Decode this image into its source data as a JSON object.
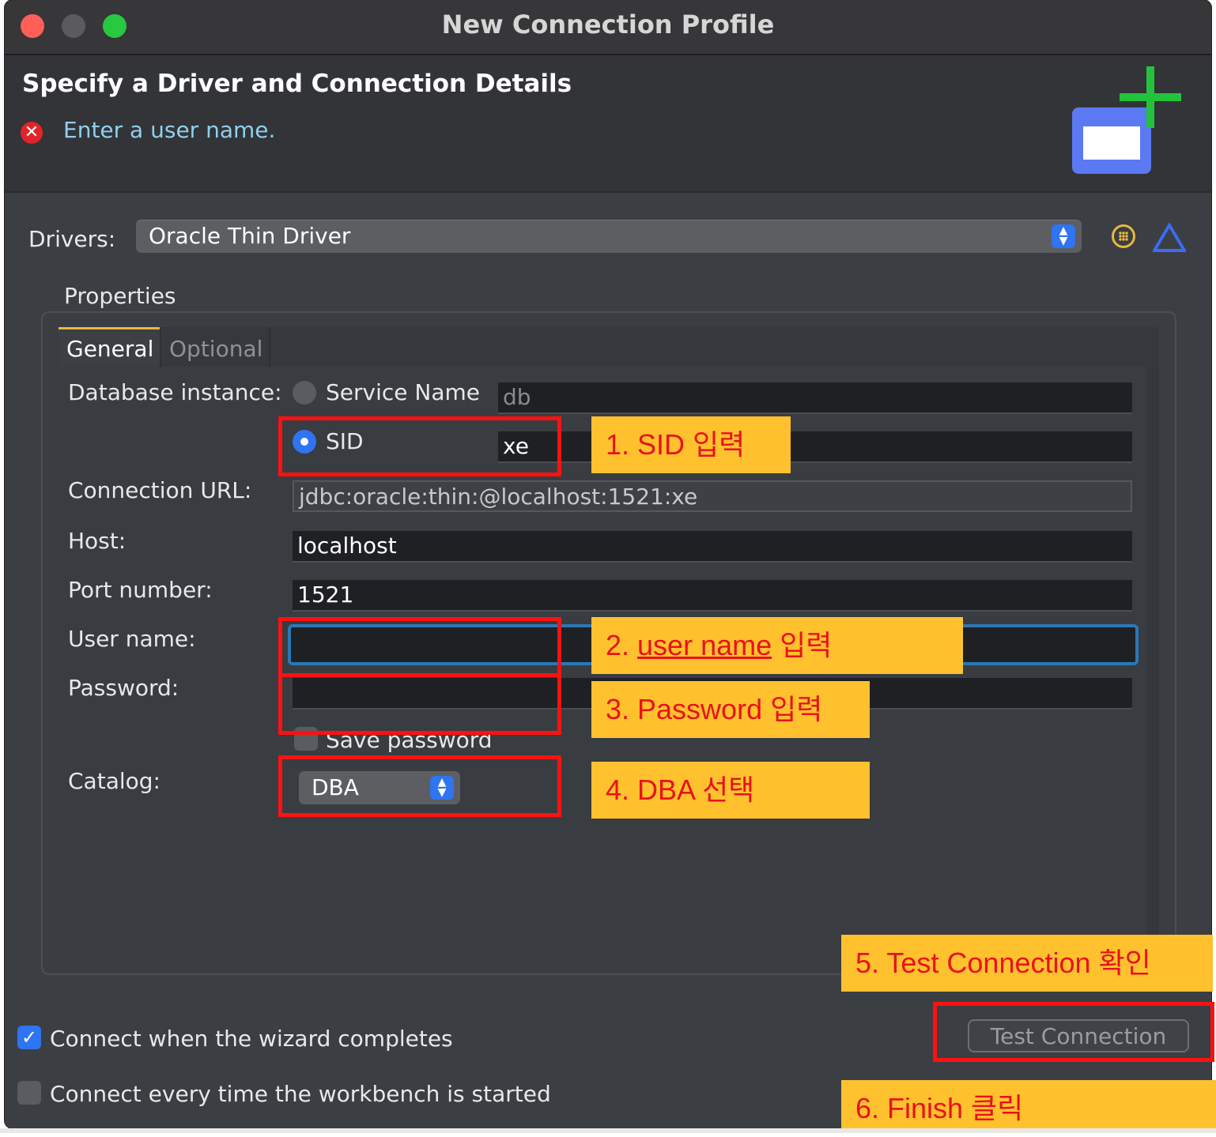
{
  "window": {
    "title": "New Connection Profile"
  },
  "header": {
    "title": "Specify a Driver and Connection Details",
    "error_message": "Enter a user name."
  },
  "drivers": {
    "label": "Drivers:",
    "selected": "Oracle Thin Driver"
  },
  "properties": {
    "group_label": "Properties",
    "tabs": [
      {
        "label": "General",
        "active": true
      },
      {
        "label": "Optional",
        "active": false
      }
    ],
    "database_instance": {
      "label": "Database instance:",
      "options": [
        {
          "label": "Service Name",
          "selected": false,
          "value": "db"
        },
        {
          "label": "SID",
          "selected": true,
          "value": "xe"
        }
      ]
    },
    "connection_url": {
      "label": "Connection URL:",
      "value": "jdbc:oracle:thin:@localhost:1521:xe"
    },
    "host": {
      "label": "Host:",
      "value": "localhost"
    },
    "port": {
      "label": "Port number:",
      "value": "1521"
    },
    "user_name": {
      "label": "User name:",
      "value": ""
    },
    "password": {
      "label": "Password:",
      "value": ""
    },
    "save_password": {
      "label": "Save password",
      "checked": false
    },
    "catalog": {
      "label": "Catalog:",
      "selected": "DBA"
    }
  },
  "options": {
    "connect_on_complete": {
      "label": "Connect when the wizard completes",
      "checked": true
    },
    "connect_on_startup": {
      "label": "Connect every time the workbench is started",
      "checked": false
    }
  },
  "buttons": {
    "test_connection": "Test Connection"
  },
  "annotations": {
    "step1": "1. SID 입력",
    "step2_prefix": "2. ",
    "step2_underlined": "user name",
    "step2_suffix": " 입력",
    "step3": "3. Password 입력",
    "step4": "4. DBA 선택",
    "step5": "5. Test Connection 확인",
    "step6": "6. Finish 클릭"
  },
  "colors": {
    "window_bg": "#3b3e43",
    "accent_blue": "#2f74f0",
    "error_red": "#e0242a",
    "callout_bg": "#ffc12e",
    "callout_text": "#e8121a",
    "highlight_box": "#ff1111"
  }
}
